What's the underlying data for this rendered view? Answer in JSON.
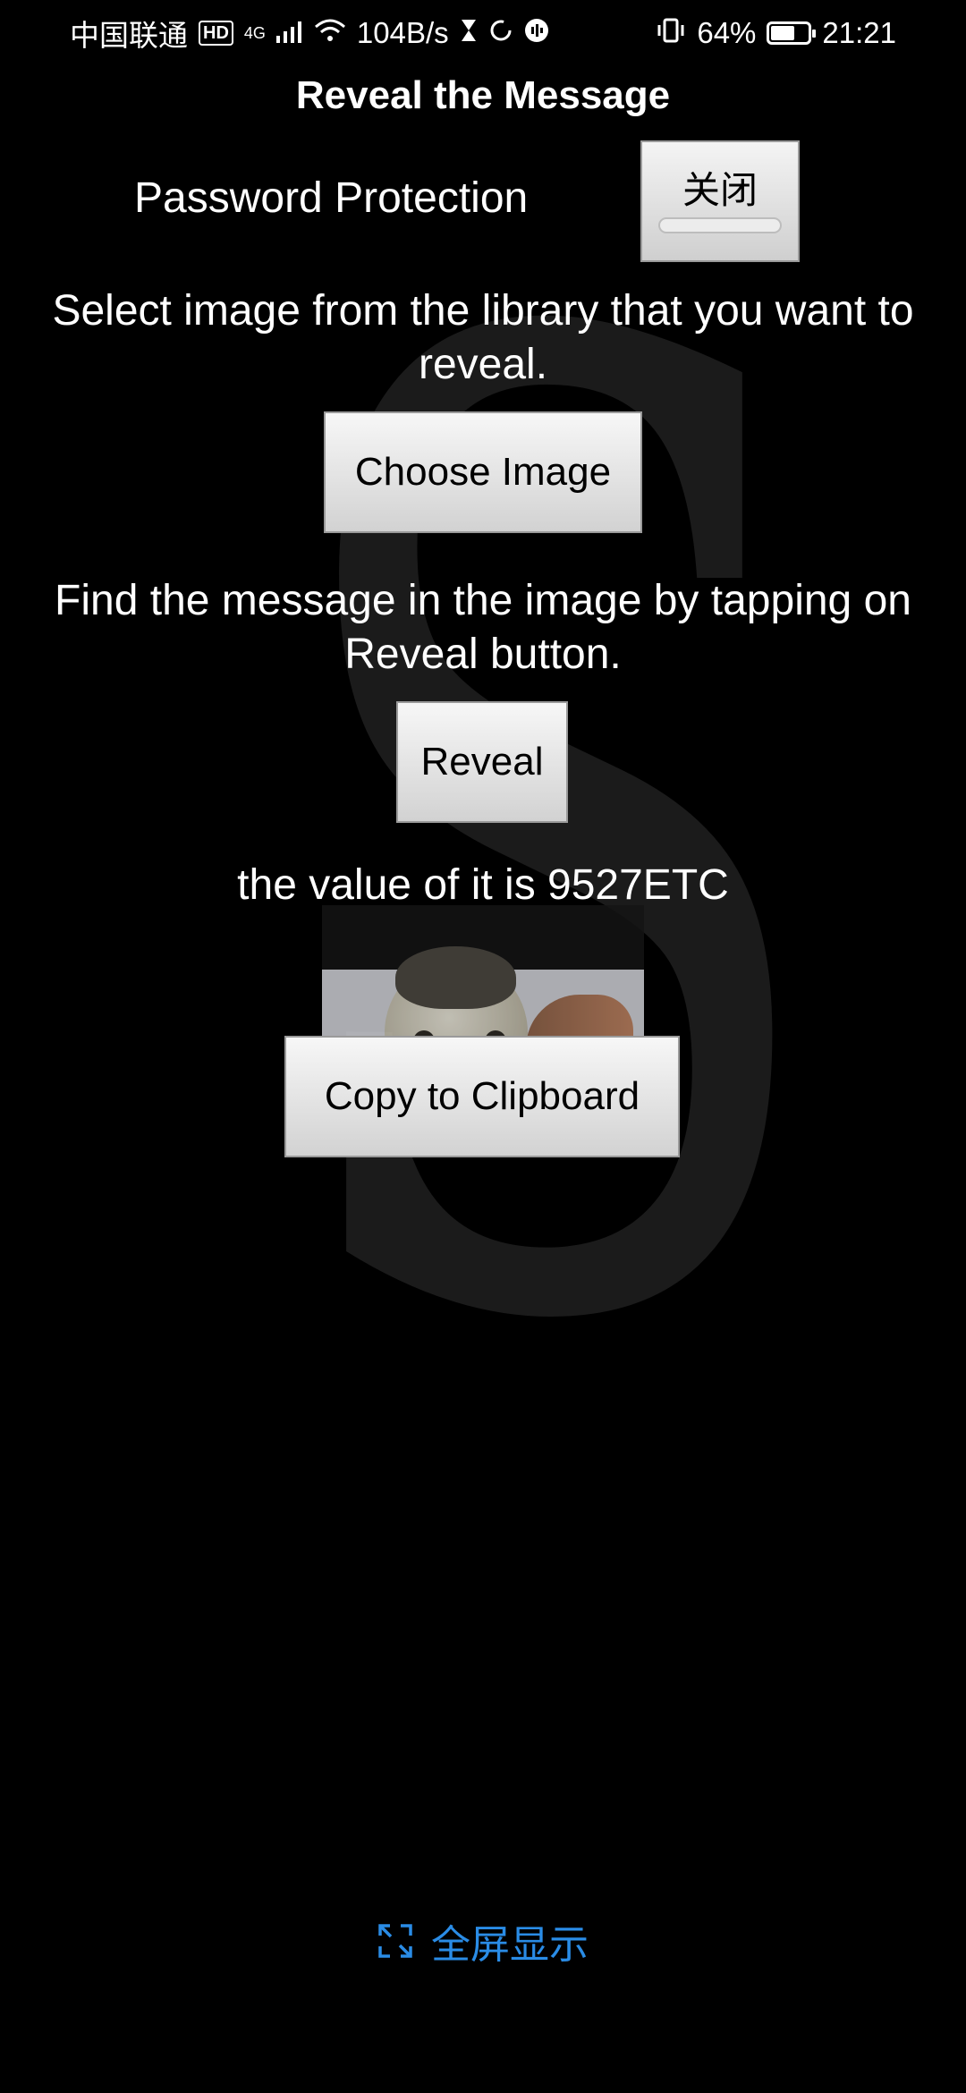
{
  "status_bar": {
    "carrier": "中国联通",
    "hd": "HD",
    "network": "4G",
    "speed": "104B/s",
    "battery_percent": "64%",
    "battery_level": 0.64,
    "time": "21:21"
  },
  "page": {
    "title": "Reveal the Message"
  },
  "password": {
    "label": "Password Protection",
    "toggle_label": "关闭"
  },
  "instructions": {
    "select_text": "Select image from the library that you want to reveal.",
    "find_text": "Find the message in the image by tapping on Reveal button."
  },
  "buttons": {
    "choose_image": "Choose Image",
    "reveal": "Reveal",
    "copy": "Copy to Clipboard"
  },
  "result": {
    "text": "the value of it is 9527ETC"
  },
  "footer": {
    "fullscreen_label": "全屏显示"
  },
  "colors": {
    "background": "#000000",
    "link_blue": "#2a8ce6",
    "button_gray": "#dcdcdc"
  },
  "icons": {
    "fullscreen": "expand-arrows-icon",
    "wifi": "wifi-icon",
    "signal": "signal-icon",
    "vibrate": "vibrate-icon",
    "hourglass": "hourglass-icon",
    "sync": "sync-icon"
  }
}
